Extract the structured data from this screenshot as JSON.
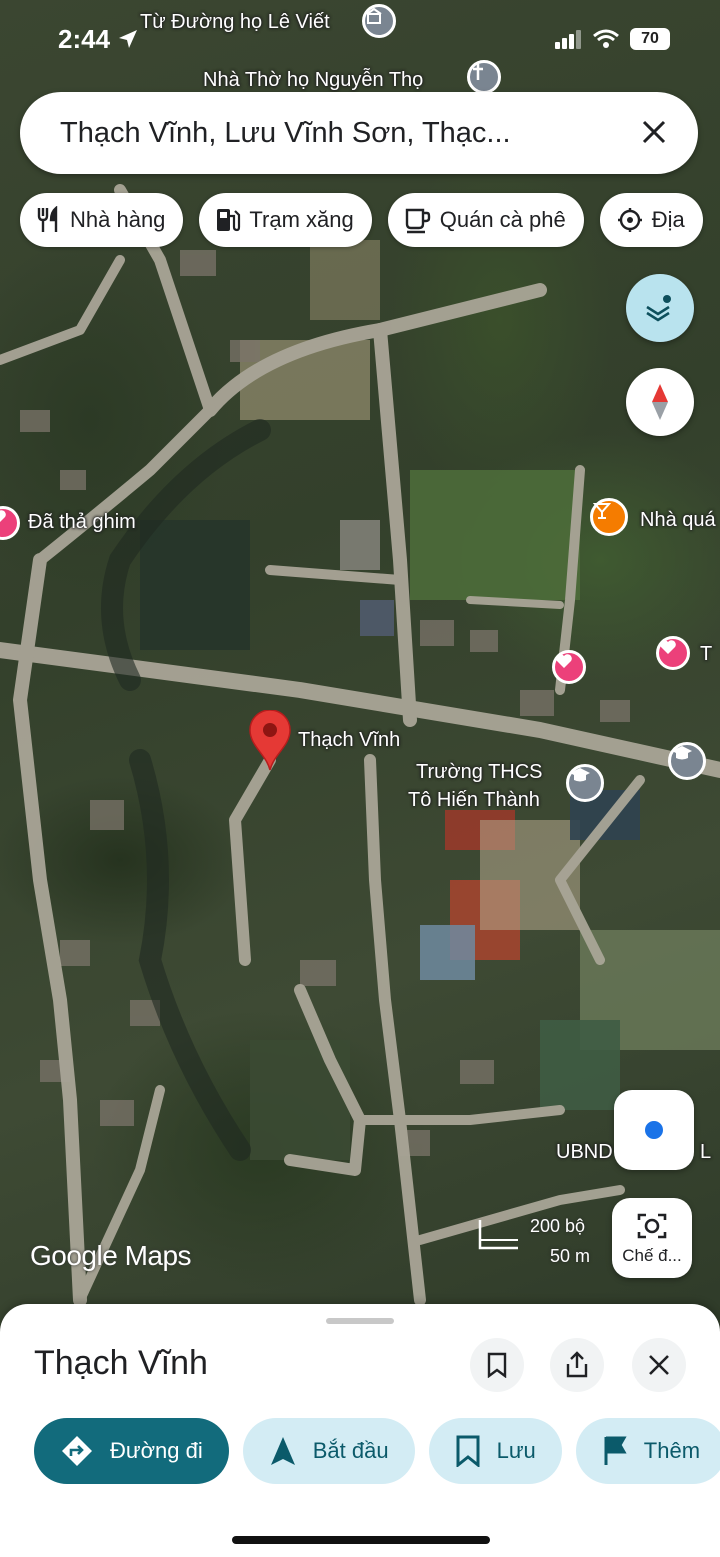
{
  "status_bar": {
    "time": "2:44",
    "battery": "70"
  },
  "search": {
    "query": "Thạch Vĩnh, Lưu Vĩnh Sơn, Thạc..."
  },
  "chips": [
    {
      "label": "Nhà hàng",
      "icon": "fork-knife-icon"
    },
    {
      "label": "Trạm xăng",
      "icon": "gas-station-icon"
    },
    {
      "label": "Quán cà phê",
      "icon": "coffee-cup-icon"
    },
    {
      "label": "Địa",
      "icon": "landmark-icon"
    }
  ],
  "map": {
    "labels": {
      "poi_top_1": "Từ Đường họ Lê Viết",
      "poi_top_2": "Nhà Thờ họ Nguyễn Thọ",
      "pinned": "Đã thả ghim",
      "bar": "Nhà quá",
      "pin_label": "Thạch Vĩnh",
      "school_line1": "Trường THCS",
      "school_line2": "Tô Hiến Thành",
      "ubnd": "UBND",
      "ubnd_suffix": "L",
      "heart_right": "T"
    },
    "brand": "Google Maps",
    "scale_top": "200 bộ",
    "scale_bottom": "50 m",
    "lens_label": "Chế đ..."
  },
  "sheet": {
    "title": "Thạch Vĩnh",
    "actions": [
      {
        "label": "Đường đi",
        "icon": "directions-icon"
      },
      {
        "label": "Bắt đầu",
        "icon": "navigation-arrow-icon"
      },
      {
        "label": "Lưu",
        "icon": "bookmark-icon"
      },
      {
        "label": "Thêm",
        "icon": "flag-icon"
      }
    ]
  },
  "colors": {
    "accent": "#126b7c",
    "accent_light": "#d3ecf4",
    "pin": "#e53935",
    "heart": "#ec407a",
    "bar_poi": "#f57c00"
  }
}
